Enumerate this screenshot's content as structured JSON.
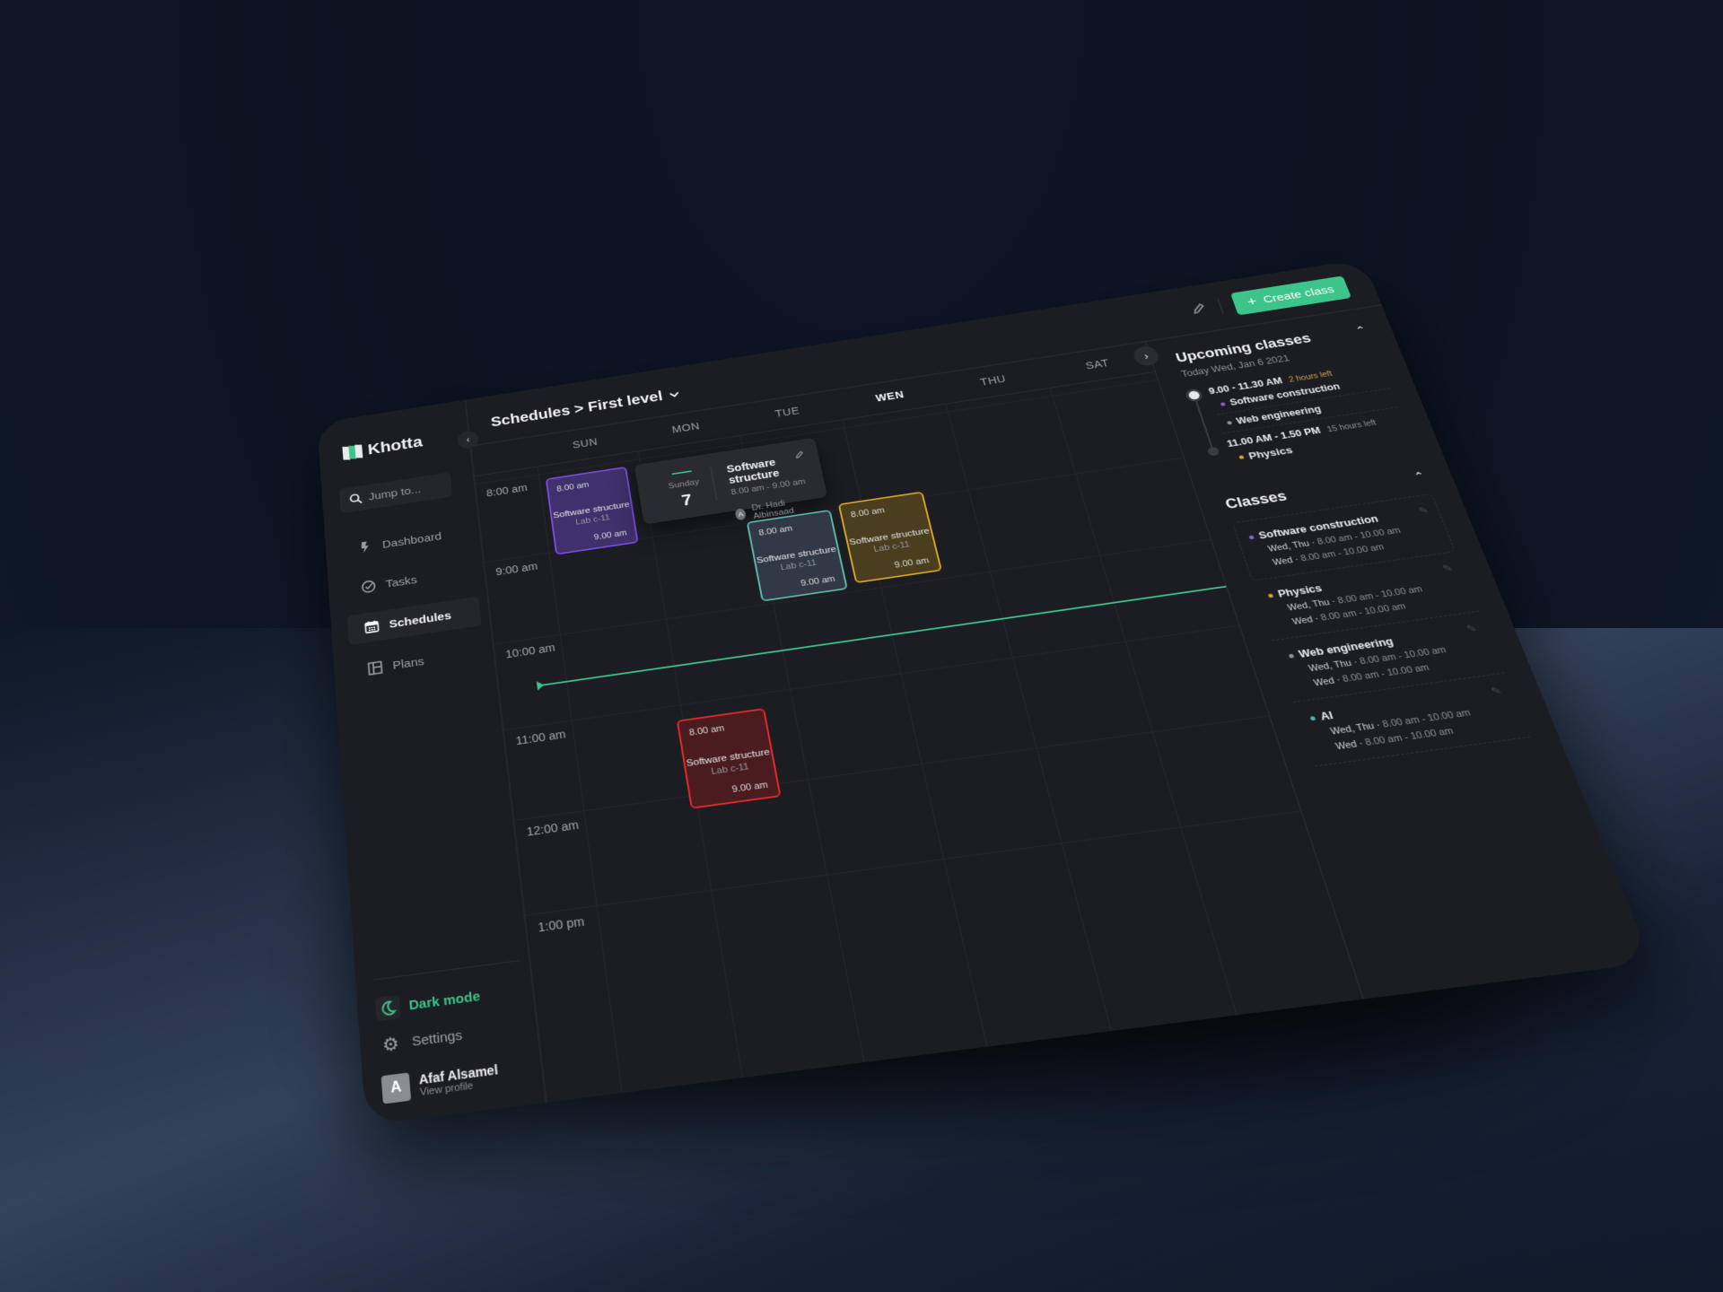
{
  "app": {
    "name": "Khotta"
  },
  "sidebar": {
    "search_placeholder": "Jump to...",
    "items": [
      {
        "label": "Dashboard",
        "icon": "bolt-icon",
        "active": false
      },
      {
        "label": "Tasks",
        "icon": "check-circle-icon",
        "active": false
      },
      {
        "label": "Schedules",
        "icon": "calendar-icon",
        "active": true
      },
      {
        "label": "Plans",
        "icon": "layout-icon",
        "active": false
      }
    ],
    "dark_mode_label": "Dark mode",
    "settings_label": "Settings",
    "user": {
      "initial": "A",
      "name": "Afaf Alsamel",
      "sub": "View profile"
    }
  },
  "header": {
    "breadcrumb": "Schedules > First level",
    "create_label": "Create class"
  },
  "calendar": {
    "days": [
      "SUN",
      "MON",
      "TUE",
      "WEN",
      "THU",
      "SAT"
    ],
    "active_day": "WEN",
    "hours": [
      "8:00 am",
      "9:00 am",
      "10:00 am",
      "11:00 am",
      "12:00 am",
      "1:00 pm"
    ],
    "events": [
      {
        "day": "SUN",
        "start": "8.00 am",
        "end": "9.00 am",
        "name": "Software structure",
        "location": "Lab c-11",
        "color": "purple"
      },
      {
        "day": "TUE",
        "start": "8.00 am",
        "end": "9.00 am",
        "name": "Software structure",
        "location": "Lab c-11",
        "color": "teal"
      },
      {
        "day": "WEN",
        "start": "8.00 am",
        "end": "9.00 am",
        "name": "Software structure",
        "location": "Lab c-11",
        "color": "yellow"
      },
      {
        "day": "MON",
        "start": "8.00 am",
        "end": "9.00 am",
        "name": "Software structure",
        "location": "Lab c-11",
        "color": "red"
      }
    ],
    "popover": {
      "weekday": "Sunday",
      "day": "7",
      "title": "Software structure",
      "time": "8.00 am - 9.00 am",
      "teacher_initial": "A",
      "teacher": "Dr. Hadi Albinsaad"
    }
  },
  "upcoming": {
    "title": "Upcoming classes",
    "subtitle": "Today Wed, Jan 6 2021",
    "slots": [
      {
        "time": "9.00 - 11.30 AM",
        "left": "2 hours left",
        "left_color": "#c9a24a",
        "classes": [
          {
            "name": "Software construction",
            "color": "#8a5cf0"
          },
          {
            "name": "Web engineering",
            "color": "#8f9198"
          }
        ]
      },
      {
        "time": "11.00 AM - 1.50 PM",
        "left": "15 hours left",
        "left_color": "#8f9198",
        "classes": [
          {
            "name": "Physics",
            "color": "#d6a428"
          }
        ]
      }
    ]
  },
  "classes": {
    "title": "Classes",
    "items": [
      {
        "name": "Software construction",
        "color": "#8a5cf0",
        "rows": [
          {
            "days": "Wed, Thu",
            "time": "8.00 am - 10.00 am"
          },
          {
            "days": "Wed",
            "time": "8.00 am - 10.00 am"
          }
        ]
      },
      {
        "name": "Physics",
        "color": "#d6a428",
        "rows": [
          {
            "days": "Wed, Thu",
            "time": "8.00 am - 10.00 am"
          },
          {
            "days": "Wed",
            "time": "8.00 am - 10.00 am"
          }
        ]
      },
      {
        "name": "Web engineering",
        "color": "#8f9198",
        "rows": [
          {
            "days": "Wed, Thu",
            "time": "8.00 am - 10.00 am"
          },
          {
            "days": "Wed",
            "time": "8.00 am - 10.00 am"
          }
        ]
      },
      {
        "name": "AI",
        "color": "#4fb3b0",
        "rows": [
          {
            "days": "Wed, Thu",
            "time": "8.00 am - 10.00 am"
          },
          {
            "days": "Wed",
            "time": "8.00 am - 10.00 am"
          }
        ]
      }
    ]
  }
}
